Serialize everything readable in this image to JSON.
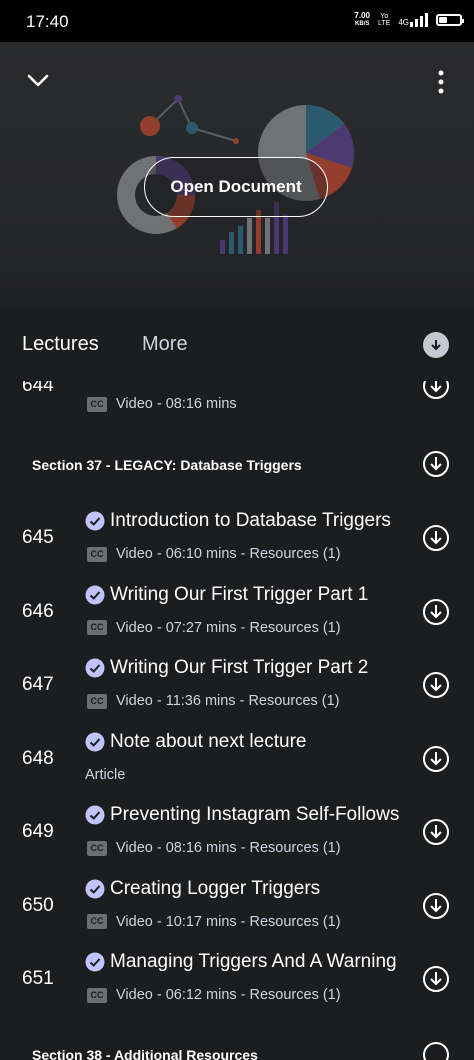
{
  "status_bar": {
    "time": "17:40",
    "speed_value": "7.00",
    "speed_unit": "KB/S",
    "volte_top": "Yo",
    "volte_bottom": "LTE",
    "network": "4G",
    "icons": [
      "signal-icon",
      "battery-icon"
    ]
  },
  "header": {
    "open_document_label": "Open Document",
    "icons": [
      "chevron-down-icon",
      "more-vertical-icon"
    ]
  },
  "tabs": {
    "lectures": "Lectures",
    "more": "More"
  },
  "partial_item": {
    "number": "644",
    "meta": "Video - 08:16 mins"
  },
  "section_37": {
    "title": "Section 37 - LEGACY: Database Triggers"
  },
  "lectures": [
    {
      "number": "645",
      "title": "Introduction to Database Triggers",
      "meta": "Video - 06:10 mins - Resources (1)",
      "type": "video"
    },
    {
      "number": "646",
      "title": "Writing Our First Trigger Part 1",
      "meta": "Video - 07:27 mins - Resources (1)",
      "type": "video"
    },
    {
      "number": "647",
      "title": "Writing Our First Trigger Part 2",
      "meta": "Video - 11:36 mins - Resources (1)",
      "type": "video"
    },
    {
      "number": "648",
      "title": "Note about next lecture",
      "meta": "Article",
      "type": "article"
    },
    {
      "number": "649",
      "title": "Preventing Instagram Self-Follows",
      "meta": "Video - 08:16 mins - Resources (1)",
      "type": "video"
    },
    {
      "number": "650",
      "title": "Creating Logger Triggers",
      "meta": "Video - 10:17 mins - Resources (1)",
      "type": "video"
    },
    {
      "number": "651",
      "title": "Managing Triggers And A Warning",
      "meta": "Video - 06:12 mins - Resources (1)",
      "type": "video"
    }
  ],
  "section_38": {
    "title": "Section 38 - Additional Resources"
  },
  "cc_label": "CC",
  "colors": {
    "background": "#1c1d1f",
    "header_bg": "#27282a",
    "check_purple": "#c0c4fc",
    "muted_text": "#d1d2e0"
  }
}
